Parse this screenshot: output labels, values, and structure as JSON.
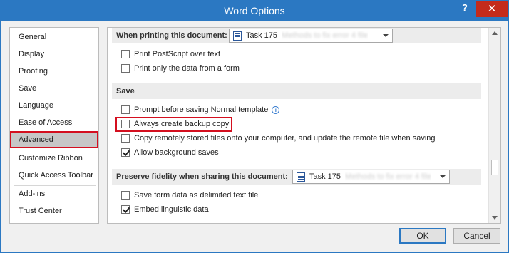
{
  "window": {
    "title": "Word Options",
    "help_glyph": "?",
    "close_glyph": "✕"
  },
  "nav": {
    "items": [
      {
        "label": "General"
      },
      {
        "label": "Display"
      },
      {
        "label": "Proofing"
      },
      {
        "label": "Save"
      },
      {
        "label": "Language"
      },
      {
        "label": "Ease of Access"
      },
      {
        "label": "Advanced",
        "selected": true
      },
      {
        "label": "Customize Ribbon"
      },
      {
        "label": "Quick Access Toolbar"
      },
      {
        "label": "Add-ins"
      },
      {
        "label": "Trust Center"
      }
    ]
  },
  "printing": {
    "header": "When printing this document:",
    "doc_name": "Task 175",
    "options": [
      {
        "label": "Print PostScript over text",
        "checked": false
      },
      {
        "label": "Print only the data from a form",
        "checked": false
      }
    ]
  },
  "save": {
    "header": "Save",
    "options": [
      {
        "label": "Prompt before saving Normal template",
        "checked": false
      },
      {
        "label": "Always create backup copy",
        "checked": false
      },
      {
        "label": "Copy remotely stored files onto your computer, and update the remote file when saving",
        "checked": false
      },
      {
        "label": "Allow background saves",
        "checked": true
      }
    ]
  },
  "fidelity": {
    "header": "Preserve fidelity when sharing this document:",
    "doc_name": "Task 175",
    "options": [
      {
        "label": "Save form data as delimited text file",
        "checked": false
      },
      {
        "label": "Embed linguistic data",
        "checked": true
      }
    ]
  },
  "buttons": {
    "ok": "OK",
    "cancel": "Cancel"
  }
}
